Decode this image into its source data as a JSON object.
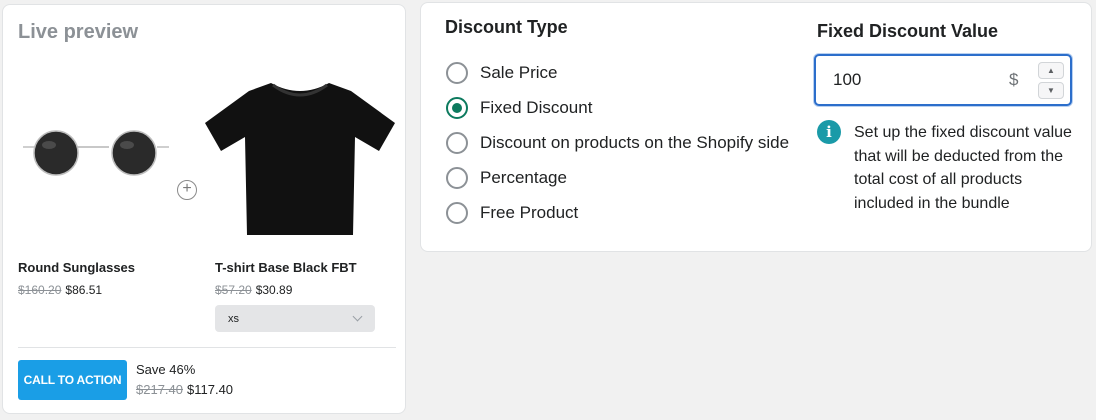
{
  "preview": {
    "title": "Live preview",
    "products": [
      {
        "name": "Round Sunglasses",
        "old_price": "$160.20",
        "price": "$86.51",
        "icon": "sunglasses-image"
      },
      {
        "name": "T-shirt Base Black FBT",
        "old_price": "$57.20",
        "price": "$30.89",
        "icon": "tshirt-image",
        "variant": "xs"
      }
    ],
    "plus_icon": "plus-circle-icon",
    "cta_label": "CALL TO ACTION",
    "save_text": "Save 46%",
    "total_old": "$217.40",
    "total_new": "$117.40",
    "cta_color": "#1a9ee6"
  },
  "discount_type": {
    "heading": "Discount Type",
    "options": [
      {
        "label": "Sale Price",
        "checked": false
      },
      {
        "label": "Fixed Discount",
        "checked": true
      },
      {
        "label": "Discount on products on the Shopify side",
        "checked": false
      },
      {
        "label": "Percentage",
        "checked": false
      },
      {
        "label": "Free Product",
        "checked": false
      }
    ],
    "accent": "#0c7a5e"
  },
  "fixed_value": {
    "heading": "Fixed Discount Value",
    "value": "100",
    "suffix": "$",
    "help": "Set up the fixed discount value that will be deducted from the total cost of all products included in the bundle",
    "info_icon": "info-icon",
    "info_color": "#1a9aa8"
  }
}
